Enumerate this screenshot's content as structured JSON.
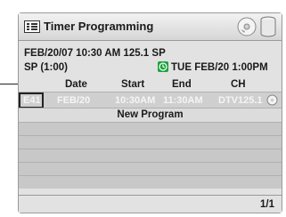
{
  "header": {
    "title": "Timer Programming",
    "icons": [
      "timer-programming-icon",
      "disc-icon",
      "hdd-can-icon"
    ]
  },
  "info": {
    "line1": "FEB/20/07 10:30 AM 125.1 SP",
    "mode": "SP (1:00)",
    "next_timer": "TUE FEB/20 1:00PM"
  },
  "table": {
    "columns": [
      "Date",
      "Start",
      "End",
      "CH"
    ],
    "rows": [
      {
        "id": "E41",
        "date": "FEB/20",
        "start": "10:30AM",
        "end": "11:30AM",
        "ch": "DTV125.1"
      }
    ],
    "new_program_label": "New Program"
  },
  "footer": {
    "page": "1/1"
  },
  "colors": {
    "timer_badge": "#1aa33a",
    "panel": "#e2e2e2"
  }
}
